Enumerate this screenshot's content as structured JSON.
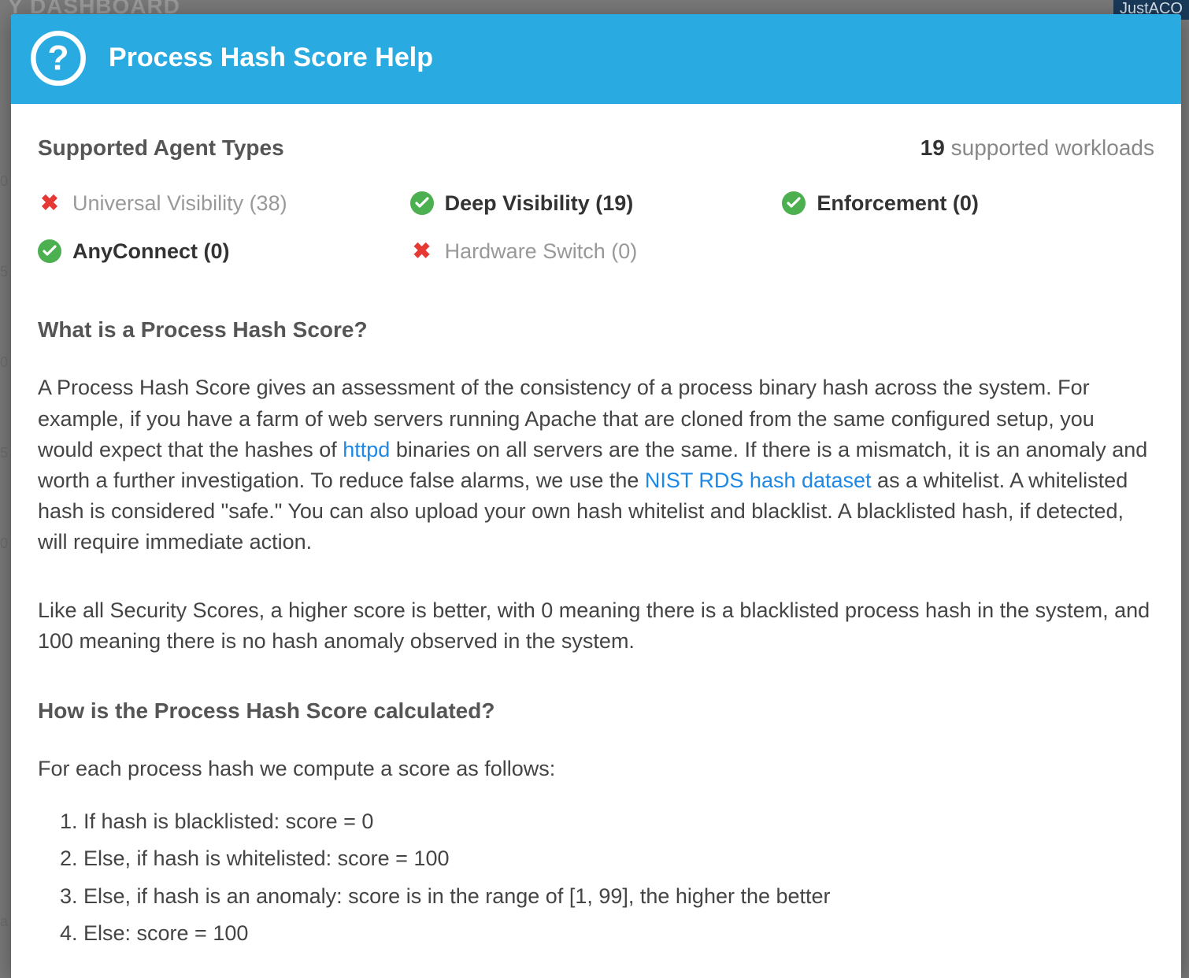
{
  "background": {
    "dashboard_fragment": "Y DASHBOARD",
    "tag_fragment": "JustACO",
    "axis_ticks": [
      "0",
      "5",
      "0",
      "5",
      "0",
      "a"
    ]
  },
  "modal": {
    "title": "Process Hash Score Help"
  },
  "supported": {
    "heading": "Supported Agent Types",
    "workloads_count": "19",
    "workloads_label": " supported workloads"
  },
  "agents": [
    {
      "name": "Universal Visibility",
      "count": "38",
      "supported": false
    },
    {
      "name": "Deep Visibility",
      "count": "19",
      "supported": true
    },
    {
      "name": "Enforcement",
      "count": "0",
      "supported": true
    },
    {
      "name": "AnyConnect",
      "count": "0",
      "supported": true
    },
    {
      "name": "Hardware Switch",
      "count": "0",
      "supported": false
    }
  ],
  "what": {
    "heading": "What is a Process Hash Score?",
    "p1_a": "A Process Hash Score gives an assessment of the consistency of a process binary hash across the system. For example, if you have a farm of web servers running Apache that are cloned from the same configured setup, you would expect that the hashes of ",
    "link1": "httpd",
    "p1_b": " binaries on all servers are the same. If there is a mismatch, it is an anomaly and worth a further investigation. To reduce false alarms, we use the ",
    "link2": "NIST RDS hash dataset",
    "p1_c": " as a whitelist. A whitelisted hash is considered \"safe.\" You can also upload your own hash whitelist and blacklist. A blacklisted hash, if detected, will require immediate action.",
    "p2": "Like all Security Scores, a higher score is better, with 0 meaning there is a blacklisted process hash in the system, and 100 meaning there is no hash anomaly observed in the system."
  },
  "how": {
    "heading": "How is the Process Hash Score calculated?",
    "intro": "For each process hash we compute a score as follows:",
    "rules": [
      "If hash is blacklisted: score = 0",
      "Else, if hash is whitelisted: score = 100",
      "Else, if hash is an anomaly: score is in the range of [1, 99], the higher the better",
      "Else: score = 100"
    ]
  }
}
